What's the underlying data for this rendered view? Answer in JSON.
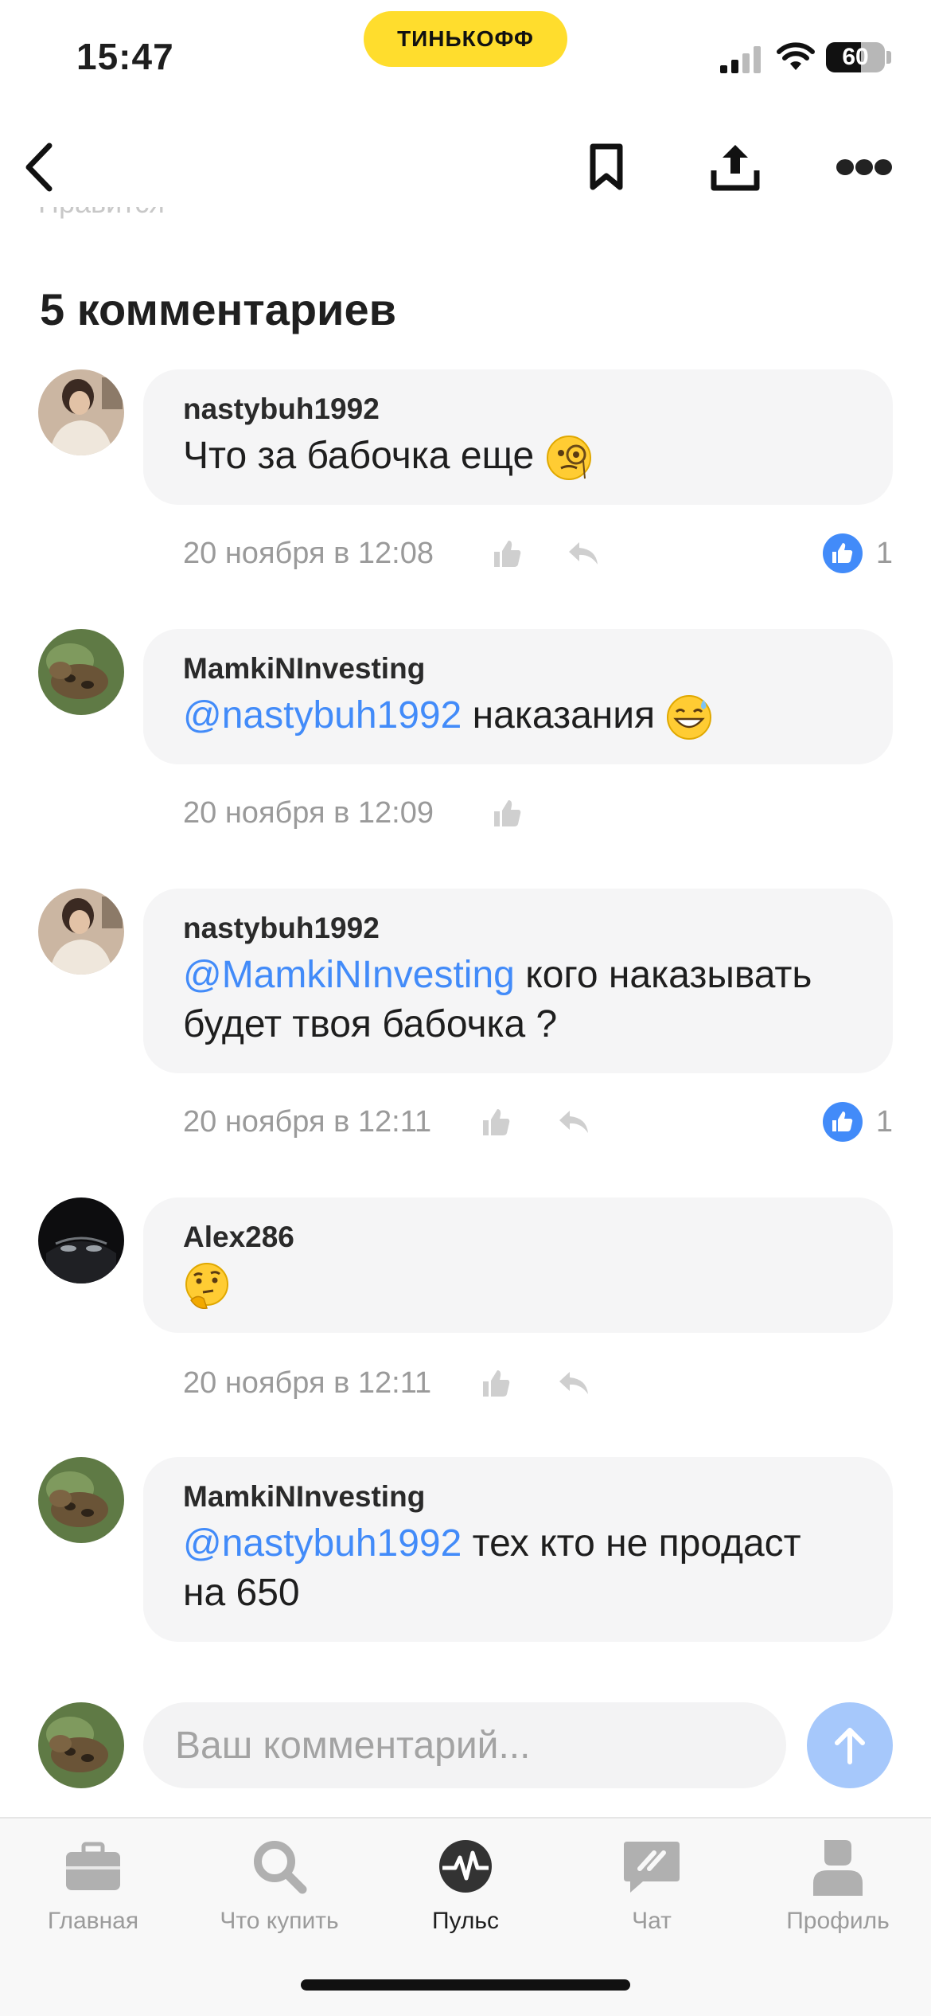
{
  "status_bar": {
    "time": "15:47",
    "brand": "ТИНЬКОФФ",
    "battery_level": 60,
    "battery_label": "60"
  },
  "top_nav": {
    "back_icon": "chevron-left-icon",
    "bookmark_icon": "bookmark-icon",
    "share_icon": "share-icon",
    "more_icon": "more-dots-icon"
  },
  "partial_text_above": "Нравится",
  "comments_section": {
    "heading": "5 комментариев",
    "comments": [
      {
        "author": "nastybuh1992",
        "mention": "",
        "text": "Что за бабочка еще",
        "emoji": "monocle-face",
        "date": "20 ноября в 12:08",
        "likes": "1",
        "has_reply": true
      },
      {
        "author": "MamkiNInvesting",
        "mention": "@nastybuh1992",
        "text": "наказания",
        "emoji": "grinning-sweat",
        "date": "20 ноября в 12:09",
        "likes": "",
        "has_reply": false
      },
      {
        "author": "nastybuh1992",
        "mention": "@MamkiNInvesting",
        "text": "кого наказывать будет твоя бабочка ?",
        "emoji": "",
        "date": "20 ноября в 12:11",
        "likes": "1",
        "has_reply": true
      },
      {
        "author": "Alex286",
        "mention": "",
        "text": "",
        "emoji": "thinking-face",
        "date": "20 ноября в 12:11",
        "likes": "",
        "has_reply": true
      },
      {
        "author": "MamkiNInvesting",
        "mention": "@nastybuh1992",
        "text": "тех кто не продаст на 650",
        "emoji": "",
        "date": "",
        "likes": "",
        "has_reply": false
      }
    ]
  },
  "comment_input": {
    "placeholder": "Ваш комментарий..."
  },
  "tab_bar": {
    "tabs": [
      {
        "label": "Главная",
        "icon": "briefcase-icon",
        "active": false
      },
      {
        "label": "Что купить",
        "icon": "search-icon",
        "active": false
      },
      {
        "label": "Пульс",
        "icon": "pulse-icon",
        "active": true
      },
      {
        "label": "Чат",
        "icon": "chat-icon",
        "active": false
      },
      {
        "label": "Профиль",
        "icon": "profile-icon",
        "active": false
      }
    ]
  },
  "colors": {
    "brand_yellow": "#ffdd2d",
    "mention_blue": "#428bf9",
    "like_blue": "#428bf9",
    "bubble_bg": "#f5f5f6",
    "send_button": "#a6c8fb"
  }
}
